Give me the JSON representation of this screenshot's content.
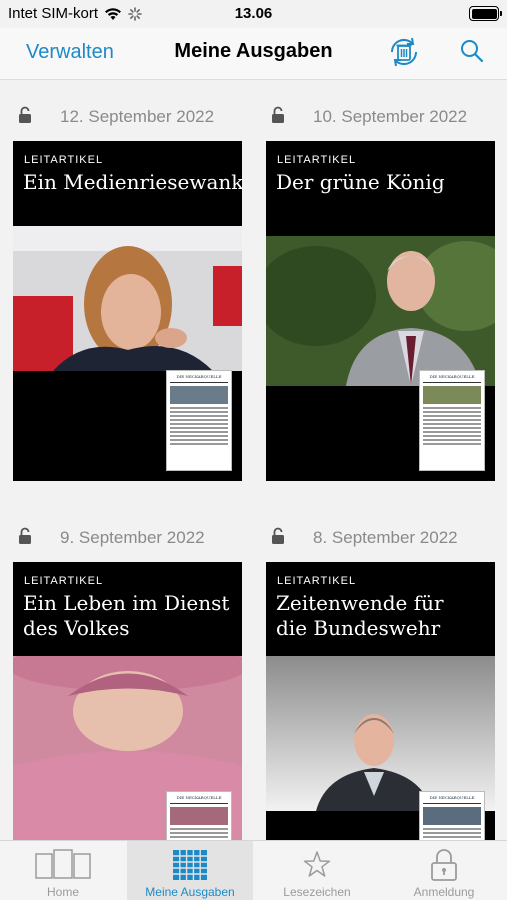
{
  "status_bar": {
    "carrier": "Intet SIM-kort",
    "time": "13.06"
  },
  "nav": {
    "manage_label": "Verwalten",
    "title": "Meine Ausgaben",
    "refresh_icon": "refresh-trash-icon",
    "search_icon": "search-icon"
  },
  "issues": [
    {
      "date": "12. September 2022",
      "kicker": "LEITARTIKEL",
      "headline_1": "Ein Medienriesewankt",
      "headline_2": ""
    },
    {
      "date": "10. September 2022",
      "kicker": "LEITARTIKEL",
      "headline_1": "Der grüne König",
      "headline_2": ""
    },
    {
      "date": "9. September 2022",
      "kicker": "LEITARTIKEL",
      "headline_1": "Ein Leben im Dienst",
      "headline_2": "des Volkes"
    },
    {
      "date": "8. September 2022",
      "kicker": "LEITARTIKEL",
      "headline_1": "Zeitenwende für",
      "headline_2": "die Bundeswehr"
    }
  ],
  "tabbar": {
    "items": [
      {
        "label": "Home",
        "icon": "home-pages-icon",
        "active": false
      },
      {
        "label": "Meine Ausgaben",
        "icon": "grid-icon",
        "active": true
      },
      {
        "label": "Lesezeichen",
        "icon": "star-icon",
        "active": false
      },
      {
        "label": "Anmeldung",
        "icon": "lock-icon",
        "active": false
      }
    ]
  },
  "colors": {
    "accent": "#1d8ac6",
    "date_gray": "#8a8a8a",
    "cover_black": "#000000",
    "background": "#f2f2f2"
  }
}
